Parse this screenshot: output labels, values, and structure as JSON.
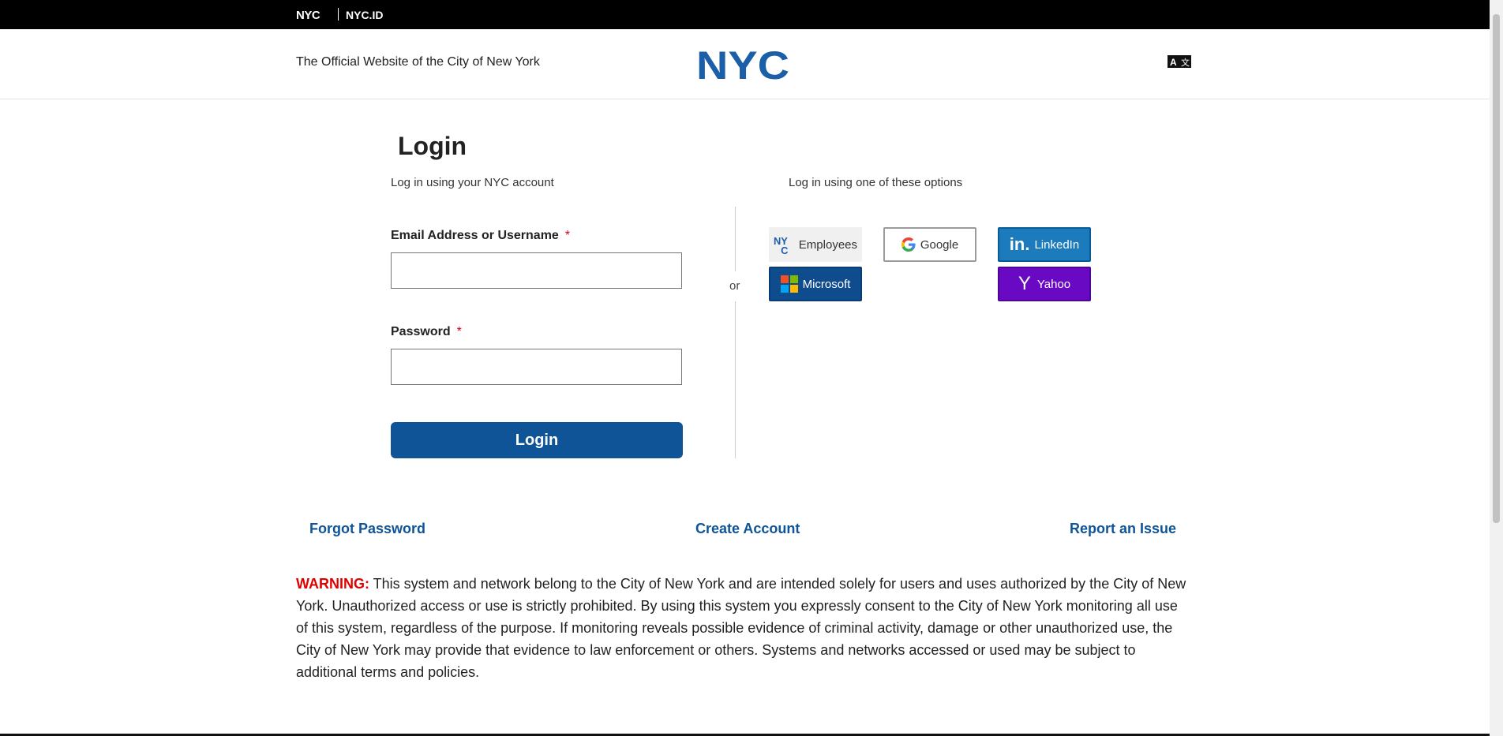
{
  "topbar": {
    "brand": "NYC",
    "product": "NYC.ID"
  },
  "header": {
    "tagline": "The Official Website of the City of New York",
    "logo_text": "NYC",
    "translate_icon": "translate-icon"
  },
  "login": {
    "title": "Login",
    "subtitle_left": "Log in using your NYC account",
    "subtitle_right": "Log in using one of these options",
    "email_label": "Email Address or Username",
    "password_label": "Password",
    "required_mark": "*",
    "email_value": "",
    "password_value": "",
    "button_label": "Login",
    "or_label": "or"
  },
  "sso": {
    "employees": "Employees",
    "google": "Google",
    "linkedin": "LinkedIn",
    "microsoft": "Microsoft",
    "yahoo": "Yahoo",
    "linkedin_logo": "in.",
    "yahoo_logo": "Y"
  },
  "links": {
    "forgot": "Forgot Password",
    "create": "Create Account",
    "report": "Report an Issue"
  },
  "warning": {
    "label": "WARNING:",
    "text": " This system and network belong to the City of New York and are intended solely for users and uses authorized by the City of New York. Unauthorized access or use is strictly prohibited. By using this system you expressly consent to the City of New York monitoring all use of this system, regardless of the purpose. If monitoring reveals possible evidence of criminal activity, damage or other unauthorized use, the City of New York may provide that evidence to law enforcement or others. Systems and networks accessed or used may be subject to additional terms and policies."
  },
  "colors": {
    "primary": "#0e5496",
    "linkedin": "#1b7bbd",
    "microsoft": "#0e4c8e",
    "yahoo": "#6a09c4",
    "warning": "#e00000"
  }
}
